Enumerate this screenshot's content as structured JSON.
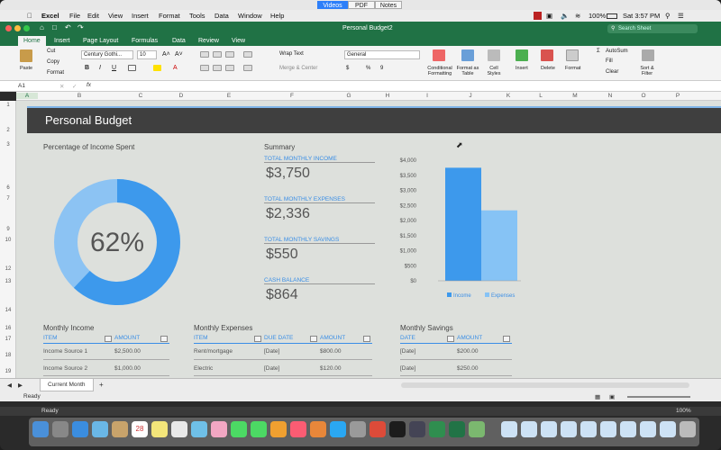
{
  "quicklook": {
    "tabs": [
      "Videos",
      "PDF",
      "Notes"
    ],
    "active": "Videos"
  },
  "menubar": {
    "app": "Excel",
    "items": [
      "File",
      "Edit",
      "View",
      "Insert",
      "Format",
      "Tools",
      "Data",
      "Window",
      "Help"
    ],
    "battery": "100%",
    "clock": "Sat 3:57 PM"
  },
  "excel": {
    "title": "Personal Budget2",
    "search_placeholder": "Search Sheet",
    "tabs": [
      "Home",
      "Insert",
      "Page Layout",
      "Formulas",
      "Data",
      "Review",
      "View"
    ],
    "active_tab": "Home"
  },
  "ribbon": {
    "paste": "Paste",
    "cut": "Cut",
    "copy": "Copy",
    "format": "Format",
    "font_name": "Century Gothi...",
    "font_size": "10",
    "wrap_text": "Wrap Text",
    "merge_center": "Merge & Center",
    "number_format": "General",
    "percent": "%",
    "comma": "9",
    "conditional": "Conditional Formatting",
    "format_table": "Format as Table",
    "cell_styles": "Cell Styles",
    "insert": "Insert",
    "delete": "Delete",
    "format_cells": "Format",
    "autosum": "AutoSum",
    "fill": "Fill",
    "clear": "Clear",
    "sort_filter": "Sort & Filter"
  },
  "formula_bar": {
    "cell_ref": "A1",
    "fx": "fx",
    "value": ""
  },
  "columns": [
    "A",
    "B",
    "C",
    "D",
    "E",
    "F",
    "G",
    "H",
    "I",
    "J",
    "K",
    "L",
    "M",
    "N",
    "O",
    "P"
  ],
  "rows": [
    "1",
    "2",
    "3",
    "6",
    "7",
    "9",
    "10",
    "12",
    "13",
    "14",
    "16",
    "17",
    "18",
    "19"
  ],
  "sheet": {
    "title": "Personal Budget",
    "donut": {
      "label": "Percentage of Income Spent",
      "percent_text": "62%",
      "value": 0.62
    },
    "summary": {
      "heading": "Summary",
      "items": [
        {
          "label": "TOTAL MONTHLY INCOME",
          "value": "$3,750"
        },
        {
          "label": "TOTAL MONTHLY EXPENSES",
          "value": "$2,336"
        },
        {
          "label": "TOTAL MONTHLY SAVINGS",
          "value": "$550"
        },
        {
          "label": "CASH BALANCE",
          "value": "$864"
        }
      ]
    },
    "monthly_income": {
      "heading": "Monthly Income",
      "headers": [
        "ITEM",
        "AMOUNT"
      ],
      "rows": [
        [
          "Income Source 1",
          "$2,500.00"
        ],
        [
          "Income Source 2",
          "$1,000.00"
        ]
      ]
    },
    "monthly_expenses": {
      "heading": "Monthly Expenses",
      "headers": [
        "ITEM",
        "DUE DATE",
        "AMOUNT"
      ],
      "rows": [
        [
          "Rent/mortgage",
          "[Date]",
          "$800.00"
        ],
        [
          "Electric",
          "[Date]",
          "$120.00"
        ]
      ]
    },
    "monthly_savings": {
      "heading": "Monthly Savings",
      "headers": [
        "DATE",
        "AMOUNT"
      ],
      "rows": [
        [
          "[Date]",
          "$200.00"
        ],
        [
          "[Date]",
          "$250.00"
        ]
      ]
    }
  },
  "chart_data": {
    "type": "bar",
    "categories": [
      "Income",
      "Expenses"
    ],
    "values": [
      3750,
      2336
    ],
    "colors": [
      "#3d99ec",
      "#86c3f5"
    ],
    "ylim": [
      0,
      4000
    ],
    "yticks": [
      "$0",
      "$500",
      "$1,000",
      "$1,500",
      "$2,000",
      "$2,500",
      "$3,000",
      "$3,500",
      "$4,000"
    ],
    "legend": [
      "Income",
      "Expenses"
    ],
    "legend_position": "bottom"
  },
  "sheet_tabs": {
    "active": "Current Month",
    "add": "+"
  },
  "status": {
    "left": "Ready",
    "zoom": "100%"
  },
  "dock": {
    "calendar_day": "28"
  }
}
